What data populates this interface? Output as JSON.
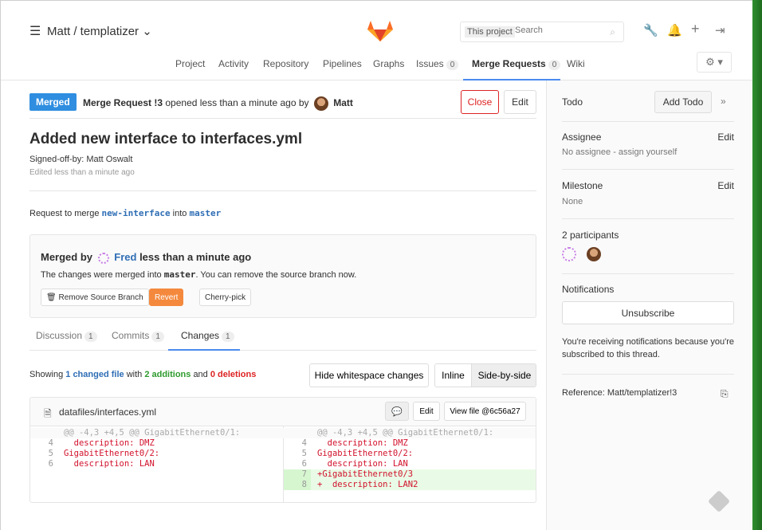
{
  "header": {
    "project_path": "Matt / templatizer ⌄",
    "search_scope": "This project",
    "search_placeholder": "Search"
  },
  "nav": [
    {
      "label": "Project"
    },
    {
      "label": "Activity"
    },
    {
      "label": "Repository"
    },
    {
      "label": "Pipelines"
    },
    {
      "label": "Graphs"
    },
    {
      "label": "Issues",
      "count": "0"
    },
    {
      "label": "Merge Requests",
      "count": "0",
      "active": true
    },
    {
      "label": "Wiki"
    }
  ],
  "mr": {
    "status": "Merged",
    "title_ref": "Merge Request !3",
    "opened_text": "opened less than a minute ago by",
    "author": "Matt",
    "close_label": "Close",
    "edit_label": "Edit",
    "title": "Added new interface to interfaces.yml",
    "signoff": "Signed-off-by: Matt Oswalt",
    "edited": "Edited less than a minute ago",
    "request_prefix": "Request to merge",
    "source_branch": "new-interface",
    "into": "into",
    "target_branch": "master"
  },
  "merged_box": {
    "merged_by": "Merged by",
    "merger": "Fred",
    "when": "less than a minute ago",
    "note_pre": "The changes were merged into",
    "note_branch": "master",
    "note_post": ". You can remove the source branch now.",
    "remove_label": "🗑 Remove Source Branch",
    "revert_label": "Revert",
    "cherry_label": "Cherry-pick"
  },
  "tabs": [
    {
      "label": "Discussion",
      "count": "1"
    },
    {
      "label": "Commits",
      "count": "1"
    },
    {
      "label": "Changes",
      "count": "1",
      "active": true
    }
  ],
  "changes": {
    "showing": "Showing",
    "files": "1 changed file",
    "with": "with",
    "additions": "2 additions",
    "and": "and",
    "deletions": "0 deletions",
    "ws_label": "Hide whitespace changes",
    "inline_label": "Inline",
    "sbs_label": "Side-by-side"
  },
  "diff": {
    "file_name": "datafiles/interfaces.yml",
    "edit_label": "Edit",
    "view_label": "View file @6c56a27",
    "left": [
      {
        "ln": "",
        "code": "@@ -4,3 +4,5 @@ GigabitEthernet0/1:",
        "type": "hunk"
      },
      {
        "ln": "4",
        "code": "  description: DMZ",
        "type": "ctx"
      },
      {
        "ln": "5",
        "code": "GigabitEthernet0/2:",
        "type": "ctx"
      },
      {
        "ln": "6",
        "code": "  description: LAN",
        "type": "ctx"
      }
    ],
    "right": [
      {
        "ln": "",
        "code": "@@ -4,3 +4,5 @@ GigabitEthernet0/1:",
        "type": "hunk"
      },
      {
        "ln": "4",
        "code": "  description: DMZ",
        "type": "ctx"
      },
      {
        "ln": "5",
        "code": "GigabitEthernet0/2:",
        "type": "ctx"
      },
      {
        "ln": "6",
        "code": "  description: LAN",
        "type": "ctx"
      },
      {
        "ln": "7",
        "code": "+GigabitEthernet0/3",
        "type": "add"
      },
      {
        "ln": "8",
        "code": "+  description: LAN2",
        "type": "add"
      }
    ]
  },
  "sidebar": {
    "todo": "Todo",
    "add_todo": "Add Todo",
    "collapse": "»",
    "assignee_label": "Assignee",
    "assignee_edit": "Edit",
    "assignee_value": "No assignee - assign yourself",
    "milestone_label": "Milestone",
    "milestone_edit": "Edit",
    "milestone_value": "None",
    "participants": "2 participants",
    "notifications": "Notifications",
    "unsubscribe": "Unsubscribe",
    "notif_text": "You're receiving notifications because you're subscribed to this thread.",
    "reference": "Reference: Matt/templatizer!3"
  },
  "colors": {
    "merged_badge": "#2f8ee0",
    "revert": "#f4893e",
    "close": "#dd2222",
    "link": "#2f6eb5",
    "additions": "#2e9b2e",
    "deletions": "#dd2222"
  },
  "icons": [
    "menu-icon",
    "gitlab-logo",
    "search-icon",
    "wrench-icon",
    "bell-icon",
    "plus-icon",
    "sign-out-icon",
    "gear-icon",
    "file-icon",
    "comment-icon",
    "copy-icon",
    "tanuki-icon"
  ]
}
